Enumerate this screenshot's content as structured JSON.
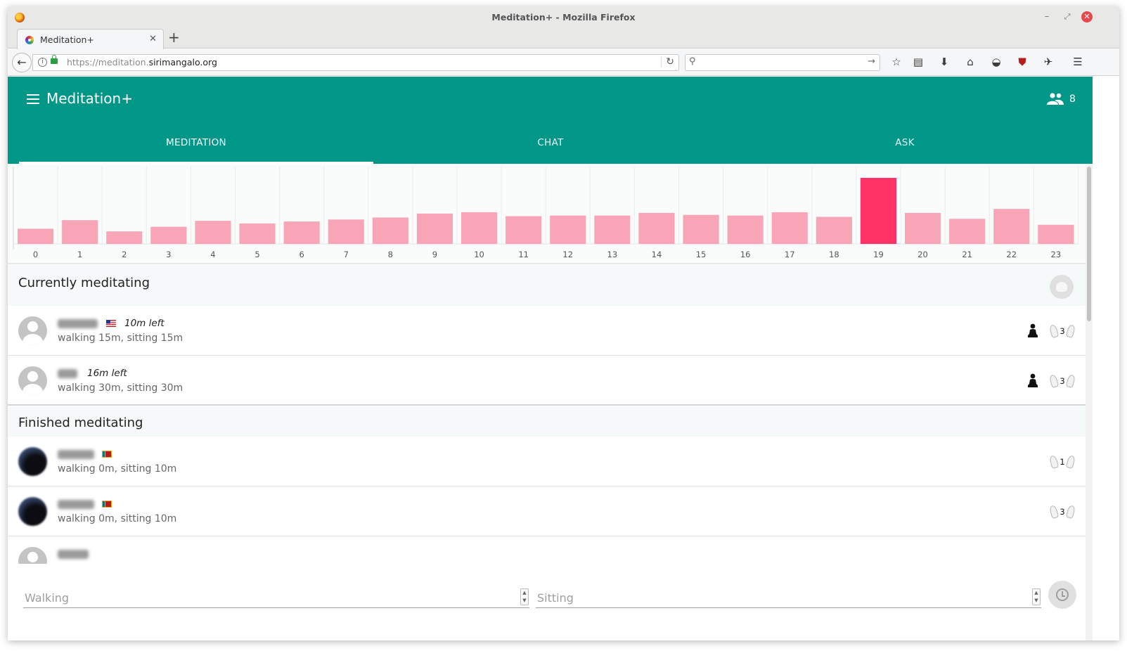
{
  "window": {
    "title": "Meditation+ - Mozilla Firefox"
  },
  "browser": {
    "tab_title": "Meditation+",
    "new_tab": "+",
    "url_protocol": "https://meditation.",
    "url_domain": "sirimangalo.org",
    "search_placeholder": ""
  },
  "app": {
    "title": "Meditation+",
    "online_count": "8",
    "tabs": [
      {
        "label": "MEDITATION"
      },
      {
        "label": "CHAT"
      },
      {
        "label": "ASK"
      }
    ]
  },
  "chart_data": {
    "type": "bar",
    "categories": [
      "0",
      "1",
      "2",
      "3",
      "4",
      "5",
      "6",
      "7",
      "8",
      "9",
      "10",
      "11",
      "12",
      "13",
      "14",
      "15",
      "16",
      "17",
      "18",
      "19",
      "20",
      "21",
      "22",
      "23"
    ],
    "values": [
      23,
      36,
      19,
      26,
      35,
      31,
      34,
      37,
      40,
      46,
      48,
      42,
      43,
      43,
      47,
      44,
      43,
      48,
      41,
      100,
      47,
      38,
      53,
      29
    ],
    "highlight_index": 19,
    "colors": {
      "bar": "#f8a5b8",
      "highlight": "#ff3366"
    },
    "ylim": [
      0,
      100
    ],
    "grid": "vertical"
  },
  "currently": {
    "heading": "Currently meditating",
    "rows": [
      {
        "left": "10m left",
        "detail": "walking 15m, sitting 15m",
        "anumodana": "3",
        "flag": "us"
      },
      {
        "left": "16m left",
        "detail": "walking 30m, sitting 30m",
        "anumodana": "3",
        "flag": ""
      }
    ]
  },
  "finished": {
    "heading": "Finished meditating",
    "rows": [
      {
        "detail": "walking 0m, sitting 10m",
        "anumodana": "1",
        "flag": "lk"
      },
      {
        "detail": "walking 0m, sitting 10m",
        "anumodana": "3",
        "flag": "lk"
      }
    ]
  },
  "form": {
    "walking_placeholder": "Walking",
    "sitting_placeholder": "Sitting"
  }
}
